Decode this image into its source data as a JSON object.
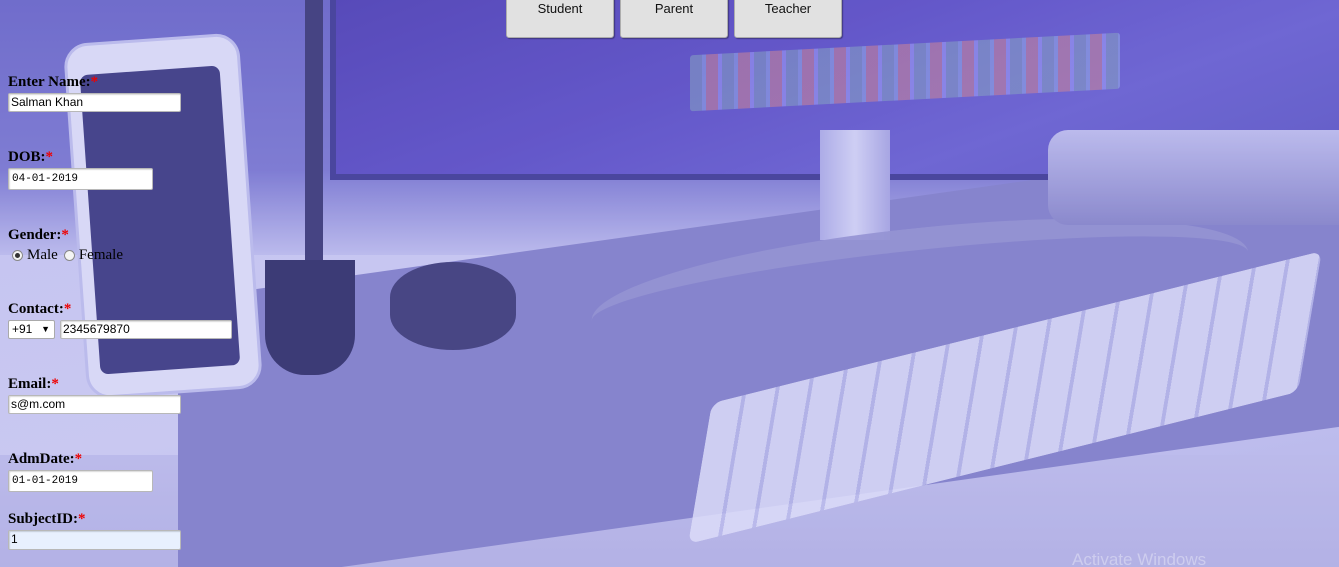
{
  "roles": [
    "Student",
    "Parent",
    "Teacher"
  ],
  "form": {
    "name": {
      "label": "Enter Name:",
      "required": "*",
      "value": "Salman Khan"
    },
    "dob": {
      "label": "DOB:",
      "required": "*",
      "value": "04-01-2019"
    },
    "gender": {
      "label": "Gender:",
      "required": "*",
      "options": [
        "Male",
        "Female"
      ],
      "selected": "Male"
    },
    "contact": {
      "label": "Contact:",
      "required": "*",
      "code": "+91",
      "value": "2345679870"
    },
    "email": {
      "label": "Email:",
      "required": "*",
      "value": "s@m.com"
    },
    "admdate": {
      "label": "AdmDate:",
      "required": "*",
      "value": "01-01-2019"
    },
    "subjectid": {
      "label": "SubjectID:",
      "required": "*",
      "value": "1"
    }
  },
  "background_watermark": "Activate Windows"
}
